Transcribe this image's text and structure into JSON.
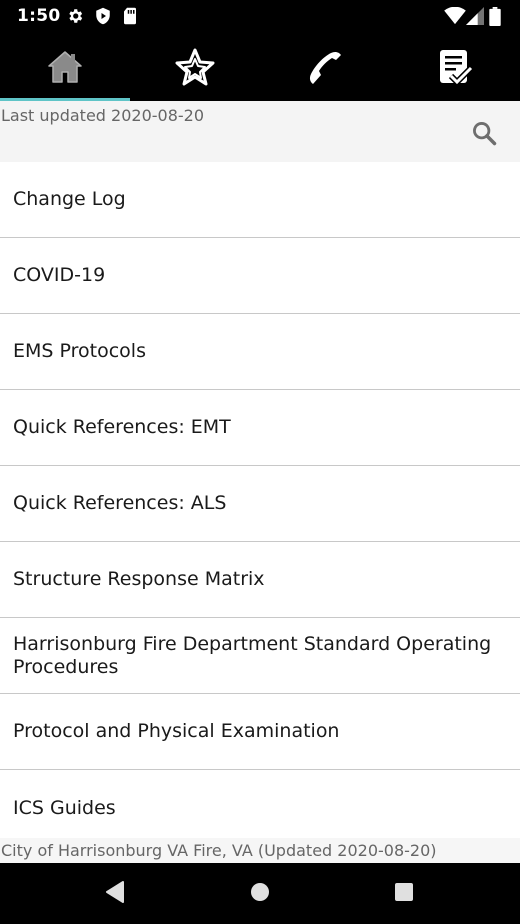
{
  "status_bar": {
    "time": "1:50",
    "left_icons": [
      "gear-icon",
      "shield-icon",
      "sd-card-icon"
    ],
    "right_icons": [
      "wifi-icon",
      "signal-icon",
      "battery-icon"
    ]
  },
  "tabs": [
    {
      "name": "home",
      "icon": "home-icon",
      "selected": true
    },
    {
      "name": "favorites",
      "icon": "star-icon",
      "selected": false
    },
    {
      "name": "contacts",
      "icon": "phone-icon",
      "selected": false
    },
    {
      "name": "checklists",
      "icon": "checklist-icon",
      "selected": false
    }
  ],
  "colors": {
    "tab_indicator": "#5fc4c7",
    "bar_background": "#000000",
    "search_bar_background": "#f4f4f4"
  },
  "header": {
    "last_updated": "Last updated 2020-08-20",
    "search_icon": "search-icon"
  },
  "list": {
    "items": [
      {
        "label": "Change Log"
      },
      {
        "label": "COVID-19"
      },
      {
        "label": "EMS Protocols"
      },
      {
        "label": "Quick References: EMT"
      },
      {
        "label": "Quick References: ALS"
      },
      {
        "label": "Structure Response Matrix"
      },
      {
        "label": "Harrisonburg Fire Department Standard Operating Procedures"
      },
      {
        "label": "Protocol and Physical Examination"
      },
      {
        "label": "ICS Guides"
      }
    ]
  },
  "footer": {
    "text": "City of Harrisonburg VA Fire, VA (Updated 2020-08-20)"
  },
  "nav_bar": {
    "buttons": [
      "back-icon",
      "home-circle-icon",
      "recents-icon"
    ]
  }
}
